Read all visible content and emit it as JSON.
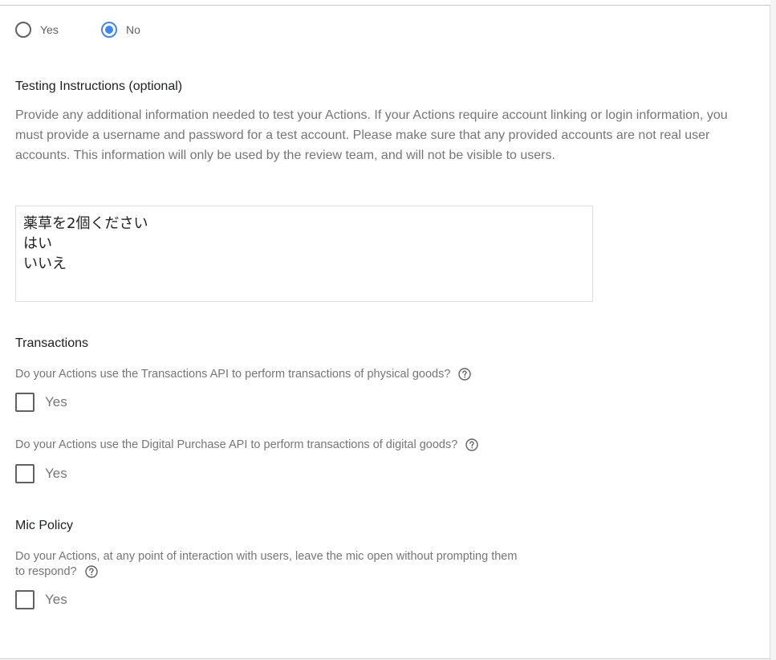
{
  "account_linking_radio": {
    "options": [
      {
        "label": "Yes",
        "selected": false
      },
      {
        "label": "No",
        "selected": true
      }
    ],
    "accent_color": "#4285f4"
  },
  "testing_instructions": {
    "heading": "Testing Instructions (optional)",
    "description": "Provide any additional information needed to test your Actions. If your Actions require account linking or login information, you must provide a username and password for a test account. Please make sure that any provided accounts are not real user accounts. This information will only be used by the review team, and will not be visible to users.",
    "value": "薬草を2個ください\nはい\nいいえ"
  },
  "transactions": {
    "heading": "Transactions",
    "physical_question": "Do your Actions use the Transactions API to perform transactions of physical goods?",
    "physical_yes_label": "Yes",
    "physical_checked": false,
    "digital_question": "Do your Actions use the Digital Purchase API to perform transactions of digital goods?",
    "digital_yes_label": "Yes",
    "digital_checked": false
  },
  "mic_policy": {
    "heading": "Mic Policy",
    "question_line1": "Do your Actions, at any point of interaction with users, leave the mic open without prompting them",
    "question_line2": "to respond?",
    "yes_label": "Yes",
    "checked": false
  },
  "icons": {
    "help": "help-circle-icon"
  }
}
